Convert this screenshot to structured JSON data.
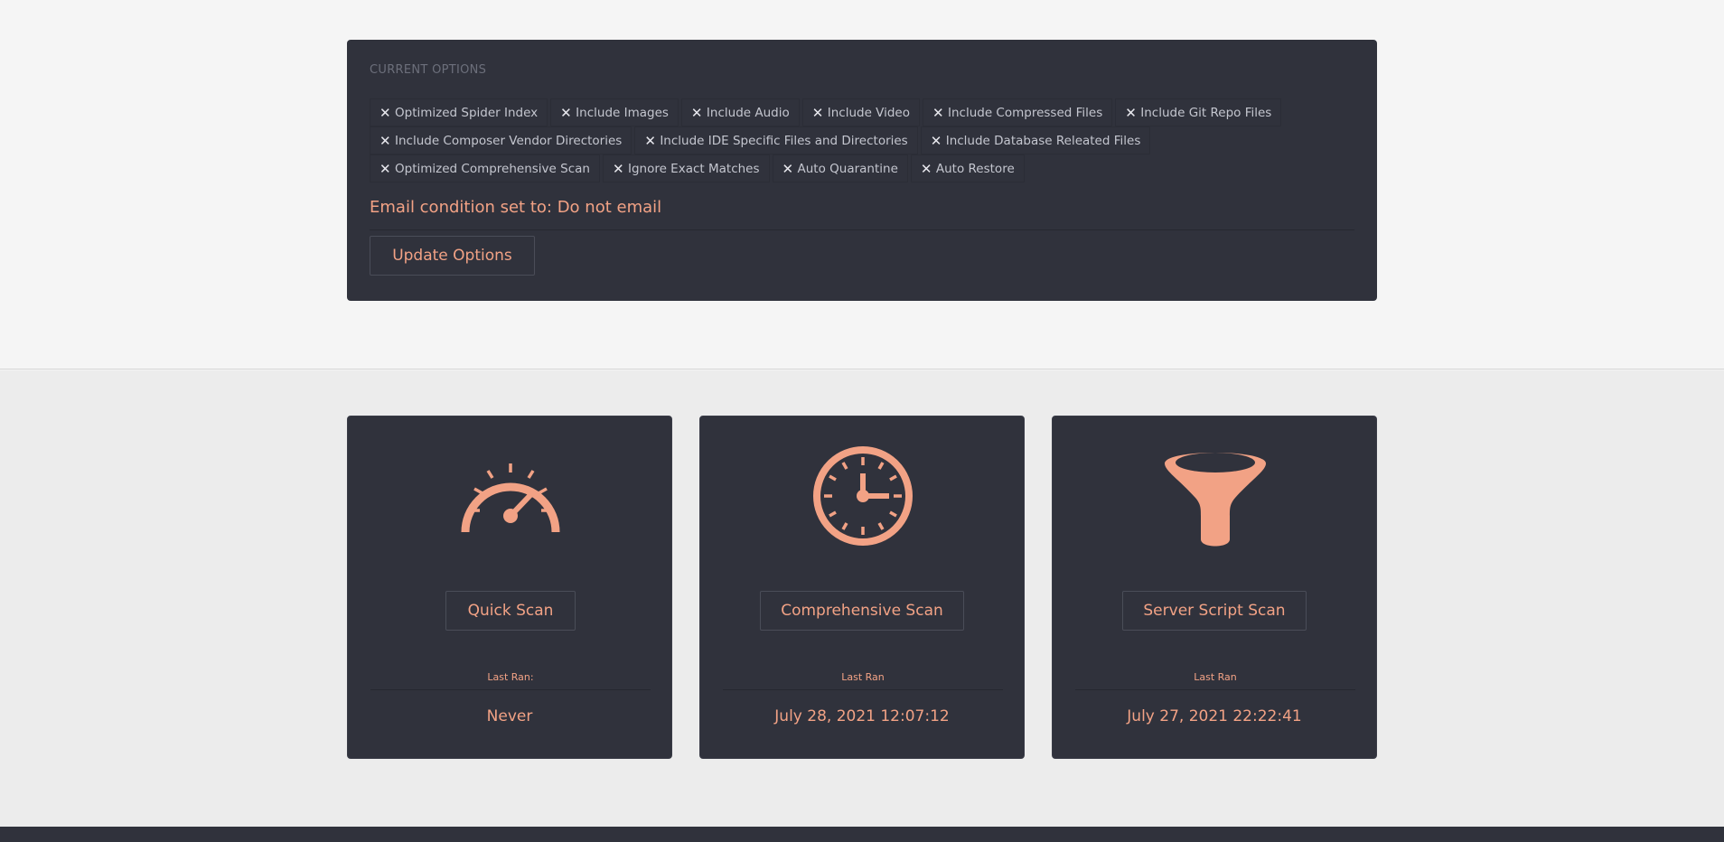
{
  "options": {
    "heading": "CURRENT OPTIONS",
    "remove_glyph": "✕",
    "tags": [
      "Optimized Spider Index",
      "Include Images",
      "Include Audio",
      "Include Video",
      "Include Compressed Files",
      "Include Git Repo Files",
      "Include Composer Vendor Directories",
      "Include IDE Specific Files and Directories",
      "Include Database Releated Files",
      "Optimized Comprehensive Scan",
      "Ignore Exact Matches",
      "Auto Quarantine",
      "Auto Restore"
    ],
    "email_condition": "Email condition set to: Do not email",
    "update_button": "Update Options"
  },
  "scans": [
    {
      "icon": "speedometer-icon",
      "button": "Quick Scan",
      "last_label": "Last Ran:",
      "last_value": "Never"
    },
    {
      "icon": "clock-icon",
      "button": "Comprehensive Scan",
      "last_label": "Last Ran",
      "last_value": "July 28, 2021 12:07:12"
    },
    {
      "icon": "funnel-icon",
      "button": "Server Script Scan",
      "last_label": "Last Ran",
      "last_value": "July 27, 2021 22:22:41"
    }
  ],
  "colors": {
    "panel_bg": "#30323c",
    "accent": "#f2a285",
    "page_bg": "#f5f5f5"
  }
}
